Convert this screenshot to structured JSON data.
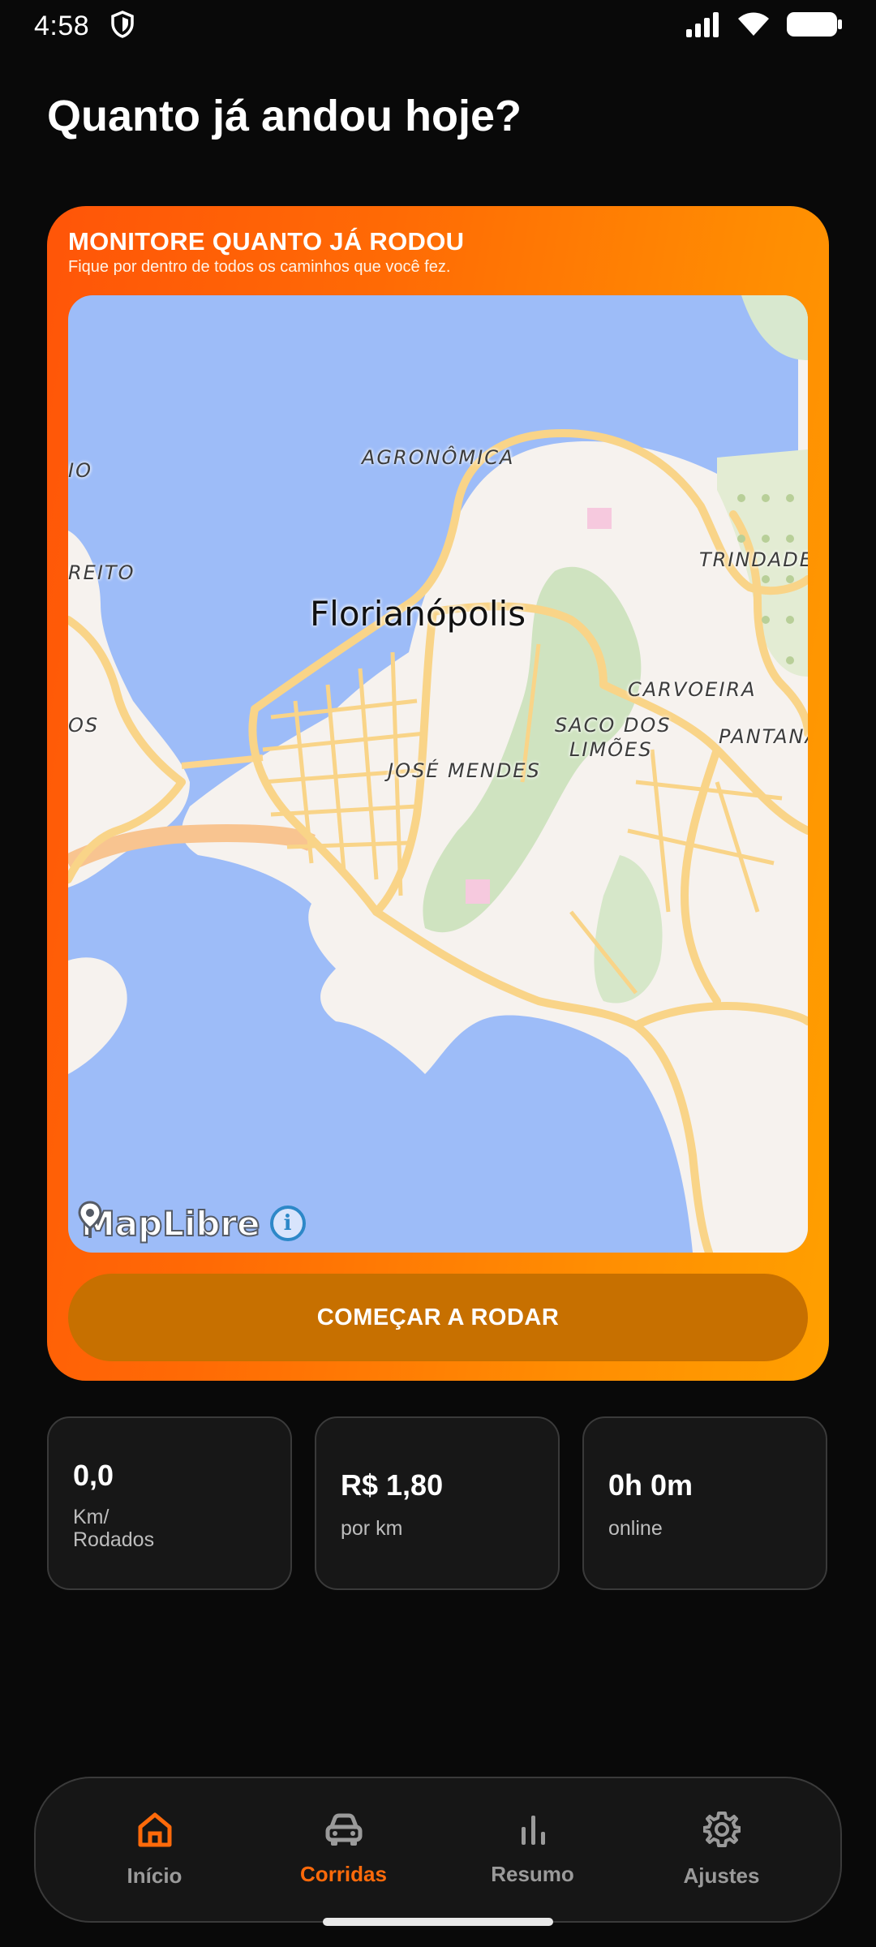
{
  "status_bar": {
    "time": "4:58",
    "icons": [
      "shield-icon",
      "signal-icon",
      "wifi-icon",
      "battery-icon"
    ]
  },
  "page": {
    "title": "Quanto já andou hoje?"
  },
  "hero": {
    "title": "MONITORE QUANTO JÁ RODOU",
    "subtitle": "Fique por dentro de todos os caminhos que você fez.",
    "map": {
      "city": "Florianópolis",
      "labels": {
        "agronomica": "AGRONÔMICA",
        "trindade": "TRINDADE",
        "carvoeira": "CARVOEIRA",
        "saco_line1": "SACO DOS",
        "saco_line2": "LIMÕES",
        "pantanal": "PANTANA",
        "jose_mendes": "JOSÉ MENDES",
        "left_io": "IO",
        "left_reito": "REITO",
        "left_os": "OS"
      },
      "attribution": "MapLibre",
      "info_label": "i"
    },
    "start_button": "COMEÇAR A RODAR",
    "accent_colors": {
      "gradient_start": "#ff5508",
      "gradient_end": "#ffa000",
      "button": "#c77000"
    }
  },
  "stats": [
    {
      "value": "0,0",
      "label_line1": "Km/",
      "label_line2": "Rodados"
    },
    {
      "value": "R$ 1,80",
      "label_line1": "por km",
      "label_line2": ""
    },
    {
      "value": "0h 0m",
      "label_line1": "online",
      "label_line2": ""
    }
  ],
  "nav": {
    "items": [
      {
        "label": "Início",
        "icon": "home-icon",
        "active": false
      },
      {
        "label": "Corridas",
        "icon": "car-icon",
        "active": true
      },
      {
        "label": "Resumo",
        "icon": "bar-chart-icon",
        "active": false
      },
      {
        "label": "Ajustes",
        "icon": "gear-icon",
        "active": false
      }
    ],
    "active_color": "#ff6a0a",
    "inactive_color": "#9a9a9a"
  }
}
